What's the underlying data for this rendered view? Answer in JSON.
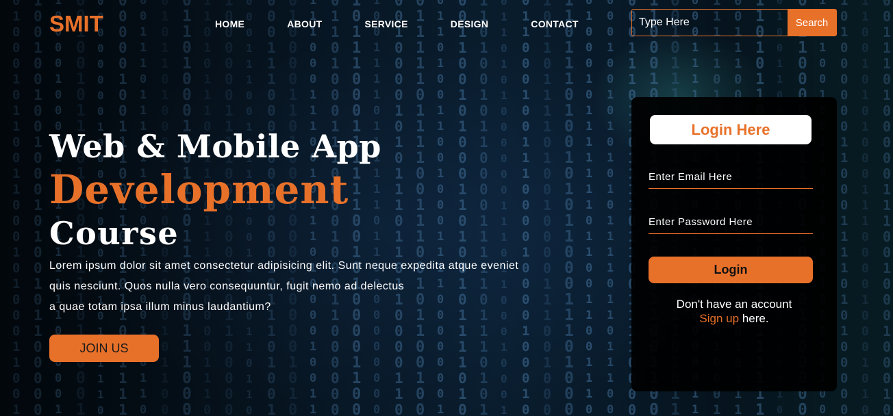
{
  "header": {
    "logo": "SMIT",
    "nav": [
      "HOME",
      "ABOUT",
      "SERVICE",
      "DESIGN",
      "CONTACT"
    ],
    "search": {
      "placeholder": "Type Here",
      "button_label": "Search"
    }
  },
  "hero": {
    "title_line1": "Web & Mobile App",
    "title_line2": "Development",
    "title_line3": "Course",
    "description": [
      "Lorem ipsum dolor sit amet consectetur adipisicing elit. Sunt neque expedita atque eveniet",
      "quis nesciunt. Quos nulla vero consequuntur, fugit nemo ad delectus",
      "a quae totam ipsa illum minus laudantium?"
    ],
    "join_label": "JOIN US"
  },
  "login": {
    "title": "Login Here",
    "email_placeholder": "Enter Email Here",
    "password_placeholder": "Enter Password Here",
    "button_label": "Login",
    "signup_prompt": "Don't have an account",
    "signup_link": "Sign up",
    "signup_suffix": " here."
  },
  "colors": {
    "accent": "#e8712a",
    "text": "#ffffff",
    "card": "#000000"
  }
}
